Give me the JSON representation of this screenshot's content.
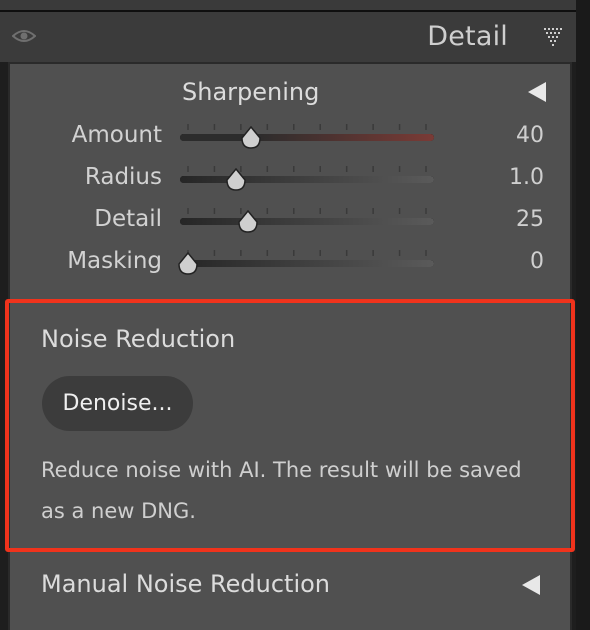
{
  "panel": {
    "title": "Detail",
    "header_icons": [
      "eye-icon",
      "panel-menu-icon"
    ]
  },
  "sharpening": {
    "title": "Sharpening",
    "sliders": [
      {
        "label": "Amount",
        "value": "40",
        "min": 0,
        "max": 150,
        "current": 40,
        "fill_color": "#7a3b36"
      },
      {
        "label": "Radius",
        "value": "1.0",
        "min": 0.5,
        "max": 3.0,
        "current": 1.0
      },
      {
        "label": "Detail",
        "value": "25",
        "min": 0,
        "max": 100,
        "current": 25
      },
      {
        "label": "Masking",
        "value": "0",
        "min": 0,
        "max": 100,
        "current": 0
      }
    ]
  },
  "noise_reduction": {
    "title": "Noise Reduction",
    "button_label": "Denoise...",
    "description": "Reduce noise with AI. The result will be saved as a new DNG.",
    "highlight_color": "#f0331c"
  },
  "manual_noise_reduction": {
    "title": "Manual Noise Reduction"
  }
}
